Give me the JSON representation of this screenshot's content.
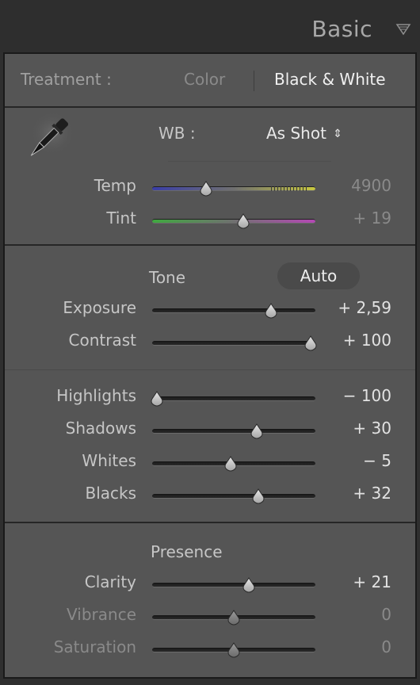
{
  "header": {
    "title": "Basic",
    "collapse_icon": "triangle-down-icon"
  },
  "treatment": {
    "label": "Treatment :",
    "options": [
      "Color",
      "Black & White"
    ],
    "selected": "Black & White"
  },
  "wb": {
    "label": "WB :",
    "value": "As Shot",
    "sliders": [
      {
        "key": "temp",
        "label": "Temp",
        "value": "4900",
        "position": 0.32
      },
      {
        "key": "tint",
        "label": "Tint",
        "value": "+ 19",
        "position": 0.56
      }
    ]
  },
  "tone": {
    "label": "Tone",
    "auto_label": "Auto",
    "sliders_a": [
      {
        "key": "exposure",
        "label": "Exposure",
        "value": "+ 2,59",
        "position": 0.74
      },
      {
        "key": "contrast",
        "label": "Contrast",
        "value": "+ 100",
        "position": 1.0
      }
    ],
    "sliders_b": [
      {
        "key": "highlights",
        "label": "Highlights",
        "value": "− 100",
        "position": 0.0
      },
      {
        "key": "shadows",
        "label": "Shadows",
        "value": "+ 30",
        "position": 0.65
      },
      {
        "key": "whites",
        "label": "Whites",
        "value": "− 5",
        "position": 0.48
      },
      {
        "key": "blacks",
        "label": "Blacks",
        "value": "+ 32",
        "position": 0.66
      }
    ]
  },
  "presence": {
    "label": "Presence",
    "sliders": [
      {
        "key": "clarity",
        "label": "Clarity",
        "value": "+ 21",
        "position": 0.6,
        "enabled": true
      },
      {
        "key": "vibrance",
        "label": "Vibrance",
        "value": "0",
        "position": 0.5,
        "enabled": false
      },
      {
        "key": "saturation",
        "label": "Saturation",
        "value": "0",
        "position": 0.5,
        "enabled": false
      }
    ]
  }
}
